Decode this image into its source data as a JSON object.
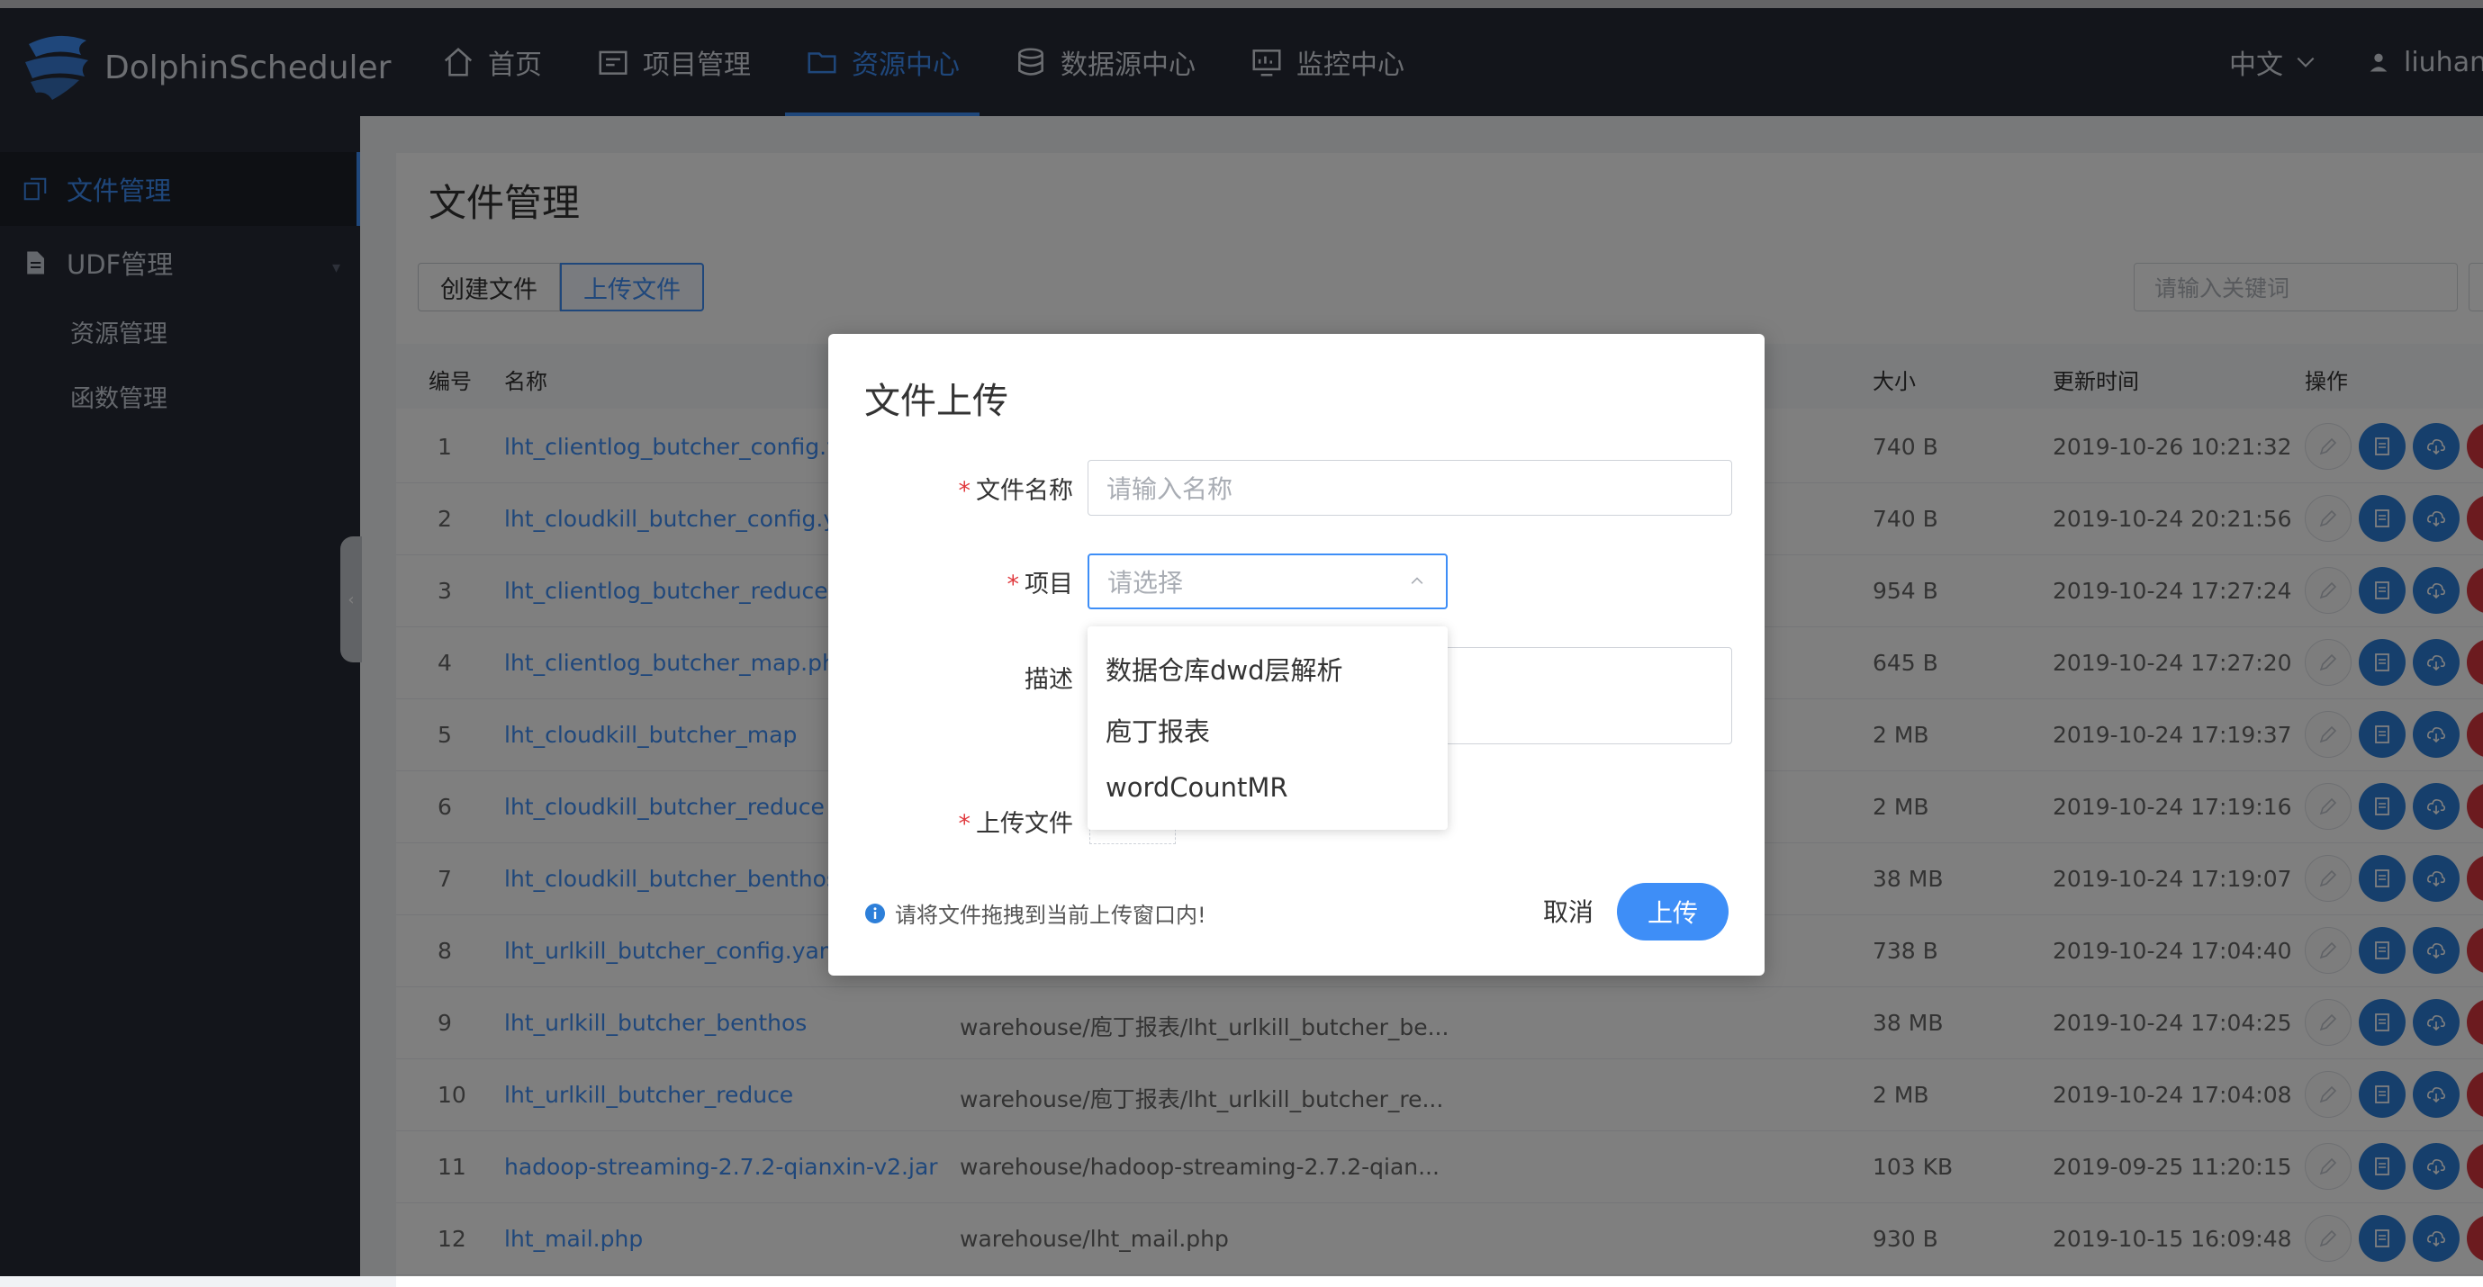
{
  "app": {
    "brand": "DolphinScheduler"
  },
  "nav": {
    "items": [
      {
        "label": "首页",
        "icon": "home-icon",
        "active": false
      },
      {
        "label": "项目管理",
        "icon": "project-icon",
        "active": false
      },
      {
        "label": "资源中心",
        "icon": "folder-icon",
        "active": true
      },
      {
        "label": "数据源中心",
        "icon": "database-icon",
        "active": false
      },
      {
        "label": "监控中心",
        "icon": "monitor-icon",
        "active": false
      }
    ],
    "language": "中文",
    "user": "liuhanti"
  },
  "sidebar": {
    "items": [
      {
        "label": "文件管理",
        "active": true
      },
      {
        "label": "UDF管理",
        "active": false
      }
    ],
    "sub_items": [
      "资源管理",
      "函数管理"
    ]
  },
  "main": {
    "title": "文件管理",
    "create_button": "创建文件",
    "upload_button": "上传文件",
    "search_placeholder": "请输入关键词",
    "columns": [
      "编号",
      "名称",
      "大小",
      "更新时间",
      "操作"
    ],
    "rows": [
      {
        "id": "1",
        "name": "lht_clientlog_butcher_config.yam",
        "path": "",
        "size": "740 B",
        "updated": "2019-10-26 10:21:32"
      },
      {
        "id": "2",
        "name": "lht_cloudkill_butcher_config.yam",
        "path": "",
        "size": "740 B",
        "updated": "2019-10-24 20:21:56"
      },
      {
        "id": "3",
        "name": "lht_clientlog_butcher_reduce.php",
        "path": "",
        "size": "954 B",
        "updated": "2019-10-24 17:27:24"
      },
      {
        "id": "4",
        "name": "lht_clientlog_butcher_map.php",
        "path": "",
        "size": "645 B",
        "updated": "2019-10-24 17:27:20"
      },
      {
        "id": "5",
        "name": "lht_cloudkill_butcher_map",
        "path": "",
        "size": "2 MB",
        "updated": "2019-10-24 17:19:37"
      },
      {
        "id": "6",
        "name": "lht_cloudkill_butcher_reduce",
        "path": "",
        "size": "2 MB",
        "updated": "2019-10-24 17:19:16"
      },
      {
        "id": "7",
        "name": "lht_cloudkill_butcher_benthos",
        "path": "",
        "size": "38 MB",
        "updated": "2019-10-24 17:19:07"
      },
      {
        "id": "8",
        "name": "lht_urlkill_butcher_config.yaml",
        "path": "",
        "size": "738 B",
        "updated": "2019-10-24 17:04:40"
      },
      {
        "id": "9",
        "name": "lht_urlkill_butcher_benthos",
        "path": "warehouse/庖丁报表/lht_urlkill_butcher_be...",
        "size": "38 MB",
        "updated": "2019-10-24 17:04:25"
      },
      {
        "id": "10",
        "name": "lht_urlkill_butcher_reduce",
        "path": "warehouse/庖丁报表/lht_urlkill_butcher_re...",
        "size": "2 MB",
        "updated": "2019-10-24 17:04:08"
      },
      {
        "id": "11",
        "name": "hadoop-streaming-2.7.2-qianxin-v2.jar",
        "path": "warehouse/hadoop-streaming-2.7.2-qian...",
        "size": "103 KB",
        "updated": "2019-09-25 11:20:15"
      },
      {
        "id": "12",
        "name": "lht_mail.php",
        "path": "warehouse/lht_mail.php",
        "size": "930 B",
        "updated": "2019-10-15 16:09:48"
      }
    ]
  },
  "modal": {
    "title": "文件上传",
    "required_mark": "*",
    "file_name_label": "文件名称",
    "file_name_placeholder": "请输入名称",
    "project_label": "项目",
    "project_placeholder": "请选择",
    "desc_label": "描述",
    "upload_label": "上传文件",
    "hint": "请将文件拖拽到当前上传窗口内!",
    "cancel": "取消",
    "submit": "上传",
    "project_options": [
      "数据仓库dwd层解析",
      "庖丁报表",
      "wordCountMR"
    ]
  },
  "colors": {
    "accent": "#3e8ef7",
    "header_bg": "#262b37",
    "danger": "#d9363e"
  }
}
